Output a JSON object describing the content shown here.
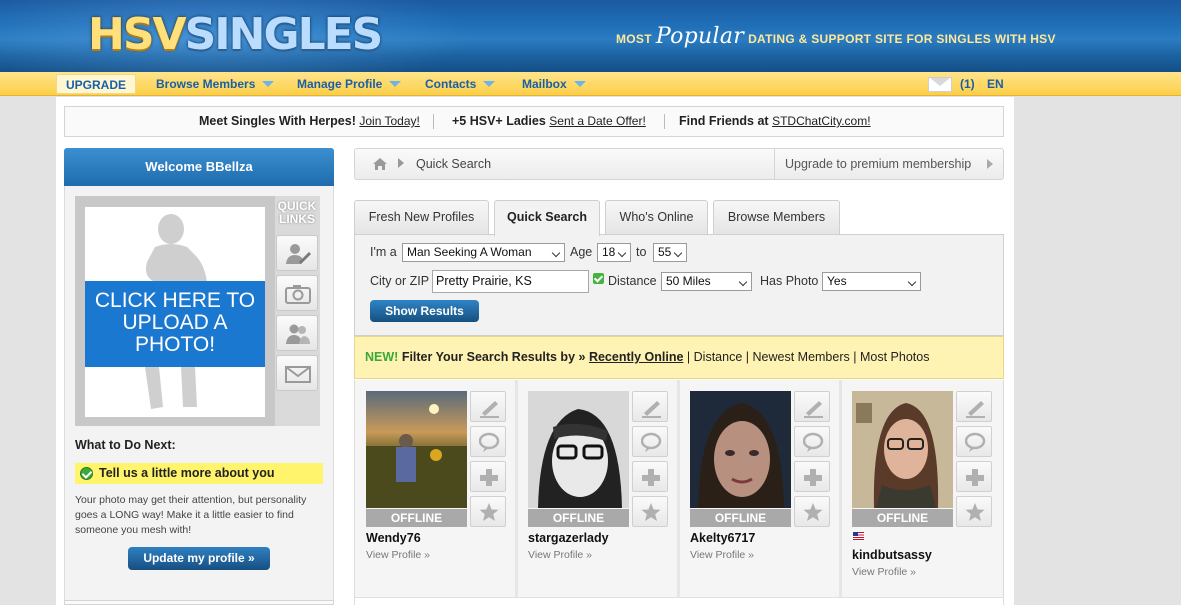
{
  "brand": {
    "logo_hsv": "HSV",
    "logo_singles": "SINGLES",
    "tagline_pre": "MOST",
    "tagline_popular": "Popular",
    "tagline_post": "DATING & SUPPORT SITE FOR SINGLES WITH HSV"
  },
  "nav": {
    "upgrade": "UPGRADE",
    "items": [
      "Browse Members",
      "Manage Profile",
      "Contacts",
      "Mailbox"
    ],
    "mail_count": "(1)",
    "lang": "EN"
  },
  "promo": {
    "seg1_bold": "Meet Singles With Herpes!",
    "seg1_link": "Join Today!",
    "seg2_bold": "+5 HSV+ Ladies",
    "seg2_link": "Sent a Date Offer!",
    "seg3_bold": "Find Friends at",
    "seg3_link": "STDChatCity.com!"
  },
  "sidebar": {
    "welcome": "Welcome BBellza",
    "upload_cta": "CLICK HERE TO UPLOAD A PHOTO!",
    "quick_links": "QUICK LINKS",
    "next_title": "What to Do Next:",
    "next_item": "Tell us a little more about you",
    "next_desc": "Your photo may get their attention, but personality goes a LONG way! Make it a little easier to find someone you mesh with!",
    "update_btn": "Update my profile »"
  },
  "breadcrumb": {
    "current": "Quick Search",
    "upgrade": "Upgrade to premium membership"
  },
  "tabs": [
    "Fresh New Profiles",
    "Quick Search",
    "Who's Online",
    "Browse Members"
  ],
  "search": {
    "im_a_label": "I'm a",
    "im_a_value": "Man Seeking A Woman",
    "age_label": "Age",
    "age_from": "18",
    "to_label": "to",
    "age_to": "55",
    "city_label": "City or ZIP",
    "city_value": "Pretty Prairie, KS",
    "distance_label": "Distance",
    "distance_value": "50 Miles",
    "photo_label": "Has Photo",
    "photo_value": "Yes",
    "show_btn": "Show Results"
  },
  "filter": {
    "new": "NEW!",
    "lead": "Filter Your Search Results by »",
    "current": "Recently Online",
    "options": [
      "Distance",
      "Newest Members",
      "Most Photos"
    ],
    "sep": "|"
  },
  "results": [
    {
      "username": "Wendy76",
      "status": "OFFLINE",
      "view": "View Profile »"
    },
    {
      "username": "stargazerlady",
      "status": "OFFLINE",
      "view": "View Profile »"
    },
    {
      "username": "Akelty6717",
      "status": "OFFLINE",
      "view": "View Profile »"
    },
    {
      "username": "kindbutsassy",
      "status": "OFFLINE",
      "view": "View Profile »",
      "flag": "us-flag-icon"
    }
  ],
  "icons": [
    "home-icon",
    "mail-icon",
    "edit-profile-icon",
    "camera-icon",
    "contacts-icon",
    "envelope-icon",
    "wink-icon",
    "chat-icon",
    "add-favorite-icon",
    "star-icon"
  ],
  "colors": {
    "header_blue": "#1f6fb7",
    "nav_yellow": "#fbcf4a",
    "link_blue": "#1a5fa6",
    "cta_blue": "#1b78d0",
    "highlight_yellow": "#fff46b",
    "filter_bg": "#fff3b3",
    "new_green": "#3aa83a"
  }
}
